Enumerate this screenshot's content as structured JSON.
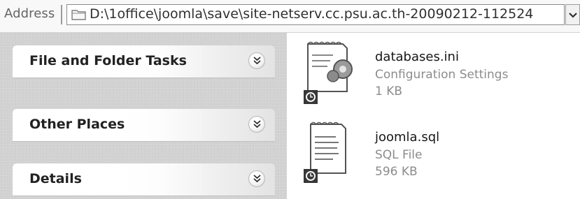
{
  "address_bar": {
    "label": "Address",
    "path": "D:\\1office\\joomla\\save\\site-netserv.cc.psu.ac.th-20090212-112524",
    "folder_icon": "folder-icon",
    "dropdown_icon": "chevron-down-icon"
  },
  "task_pane": {
    "panels": [
      {
        "title": "File and Folder Tasks",
        "icon": "double-chevron-down-icon"
      },
      {
        "title": "Other Places",
        "icon": "double-chevron-down-icon"
      },
      {
        "title": "Details",
        "icon": "double-chevron-down-icon"
      }
    ]
  },
  "files": [
    {
      "name": "databases.ini",
      "type": "Configuration Settings",
      "size": "1 KB",
      "icon": "config-settings-file-icon"
    },
    {
      "name": "joomla.sql",
      "type": "SQL File",
      "size": "596 KB",
      "icon": "text-file-icon"
    }
  ]
}
